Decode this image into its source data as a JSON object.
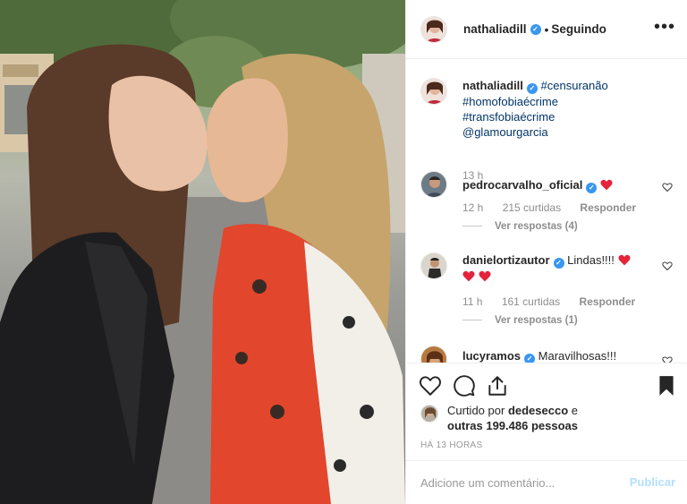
{
  "header": {
    "username": "nathaliadill",
    "separator": "•",
    "follow_status": "Seguindo",
    "more": "•••"
  },
  "caption": {
    "username": "nathaliadill",
    "hashtags": [
      "#censuranão",
      "#homofobiaécrime",
      "#transfobiaécrime"
    ],
    "mention": "@glamourgarcia",
    "time": "13 h"
  },
  "comments": [
    {
      "username": "pedrocarvalho_oficial",
      "text": "",
      "time": "12 h",
      "likes": "215 curtidas",
      "reply": "Responder",
      "view_replies": "Ver respostas (4)"
    },
    {
      "username": "danielortizautor",
      "text": "Lindas!!!!",
      "time": "11 h",
      "likes": "161 curtidas",
      "reply": "Responder",
      "view_replies": "Ver respostas (1)"
    },
    {
      "username": "lucyramos",
      "text": "Maravilhosas!!!"
    }
  ],
  "likes": {
    "prefix": "Curtido por",
    "user": "dedesecco",
    "connector": "e",
    "others": "outras 199.486 pessoas"
  },
  "time_ago": "HÁ 13 HORAS",
  "comment_box": {
    "placeholder": "Adicione um comentário...",
    "publish": "Publicar"
  },
  "colors": {
    "verified": "#3897f0",
    "link": "#003569",
    "heart": "#ed4956",
    "publish_disabled": "#b2dffc"
  }
}
